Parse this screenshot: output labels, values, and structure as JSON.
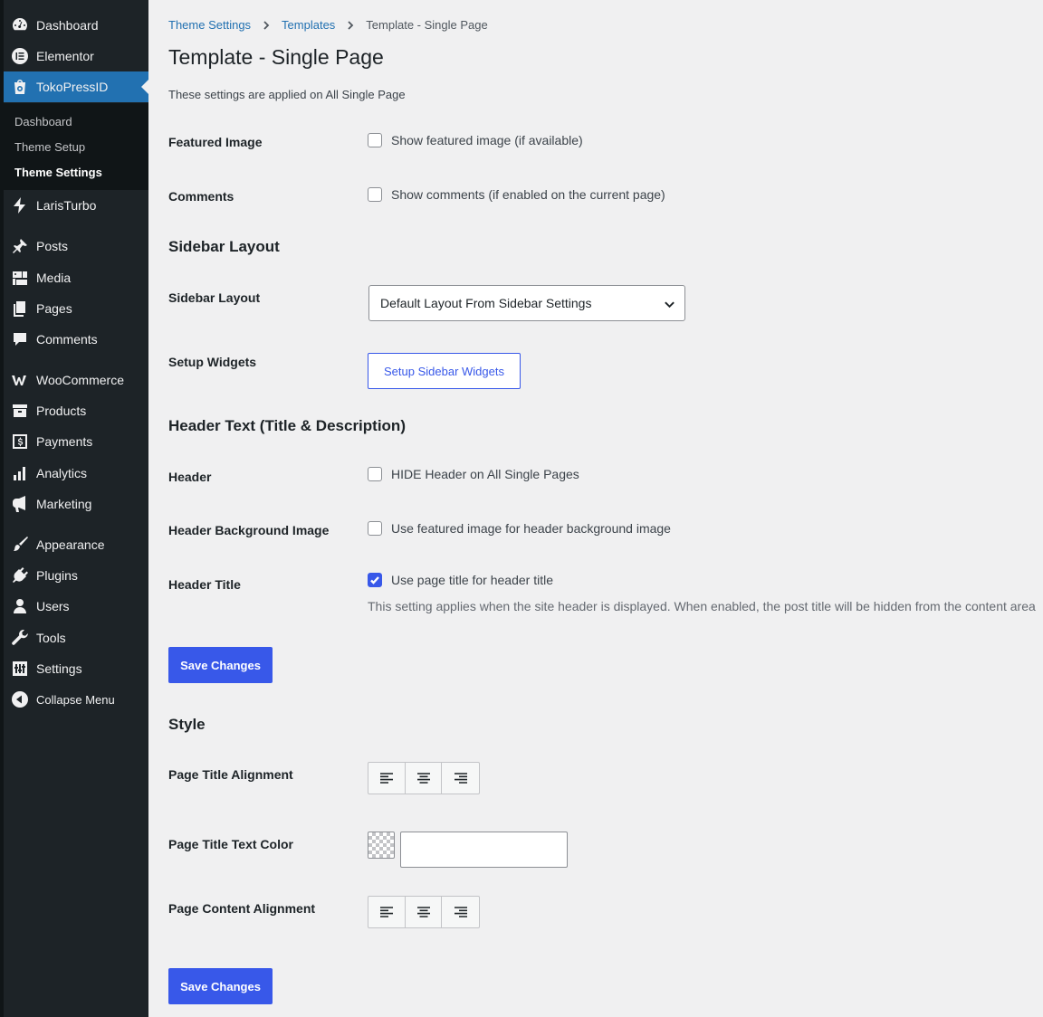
{
  "sidebar": {
    "items": [
      {
        "label": "Dashboard",
        "icon": "dashboard-icon"
      },
      {
        "label": "Elementor",
        "icon": "elementor-icon"
      },
      {
        "label": "TokoPressID",
        "icon": "tokopress-icon"
      },
      {
        "label": "LarisTurbo",
        "icon": "laristurbo-icon"
      },
      {
        "label": "Posts",
        "icon": "pin-icon"
      },
      {
        "label": "Media",
        "icon": "media-icon"
      },
      {
        "label": "Pages",
        "icon": "pages-icon"
      },
      {
        "label": "Comments",
        "icon": "comment-icon"
      },
      {
        "label": "WooCommerce",
        "icon": "woocommerce-icon"
      },
      {
        "label": "Products",
        "icon": "archive-icon"
      },
      {
        "label": "Payments",
        "icon": "payments-icon"
      },
      {
        "label": "Analytics",
        "icon": "bar-chart-icon"
      },
      {
        "label": "Marketing",
        "icon": "megaphone-icon"
      },
      {
        "label": "Appearance",
        "icon": "paintbrush-icon"
      },
      {
        "label": "Plugins",
        "icon": "plug-icon"
      },
      {
        "label": "Users",
        "icon": "user-icon"
      },
      {
        "label": "Tools",
        "icon": "wrench-icon"
      },
      {
        "label": "Settings",
        "icon": "sliders-icon"
      },
      {
        "label": "Collapse Menu",
        "icon": "collapse-icon"
      }
    ],
    "submenu": [
      "Dashboard",
      "Theme Setup",
      "Theme Settings"
    ]
  },
  "breadcrumb": [
    "Theme Settings",
    "Templates",
    "Template - Single Page"
  ],
  "page": {
    "title": "Template - Single Page",
    "description": "These settings are applied on All Single Page"
  },
  "fields": {
    "featured_image": {
      "label": "Featured Image",
      "option": "Show featured image (if available)",
      "checked": false
    },
    "comments": {
      "label": "Comments",
      "option": "Show comments (if enabled on the current page)",
      "checked": false
    },
    "sidebar_section": "Sidebar Layout",
    "sidebar_layout": {
      "label": "Sidebar Layout",
      "value": "Default Layout From Sidebar Settings"
    },
    "setup_widgets": {
      "label": "Setup Widgets",
      "button": "Setup Sidebar Widgets"
    },
    "header_section": "Header Text (Title & Description)",
    "header": {
      "label": "Header",
      "option": "HIDE Header on All Single Pages",
      "checked": false
    },
    "header_bg": {
      "label": "Header Background Image",
      "option": "Use featured image for header background image",
      "checked": false
    },
    "header_title": {
      "label": "Header Title",
      "option": "Use page title for header title",
      "checked": true,
      "hint": "This setting applies when the site header is displayed. When enabled, the post title will be hidden from the content area"
    },
    "save_label": "Save Changes",
    "style_section": "Style",
    "title_alignment": {
      "label": "Page Title Alignment"
    },
    "title_color": {
      "label": "Page Title Text Color",
      "value": ""
    },
    "content_alignment": {
      "label": "Page Content Alignment"
    },
    "save_label_2": "Save Changes"
  },
  "colors": {
    "accent": "#3858e9",
    "menu_bg": "#1d2327",
    "menu_current": "#2271b1",
    "link": "#2271b1"
  }
}
